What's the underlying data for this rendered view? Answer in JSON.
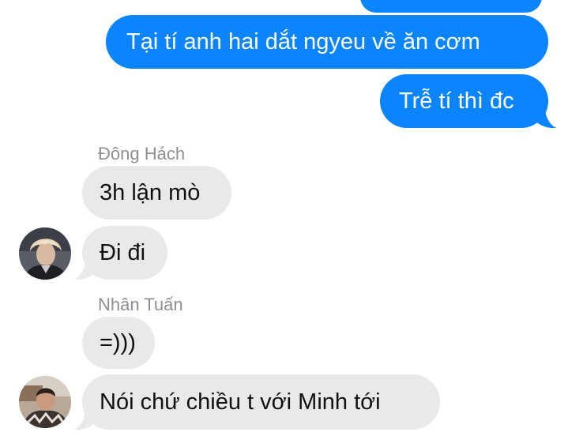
{
  "conversation": {
    "messages": [
      {
        "id": "m0",
        "direction": "outgoing",
        "text": ""
      },
      {
        "id": "m1",
        "direction": "outgoing",
        "text": "Tại tí anh hai dắt ngyeu về ăn cơm"
      },
      {
        "id": "m2",
        "direction": "outgoing",
        "text": "Trễ tí thì đc"
      },
      {
        "id": "m3",
        "direction": "incoming",
        "sender": "Đông Hách",
        "text": "3h lận mò"
      },
      {
        "id": "m4",
        "direction": "incoming",
        "text": "Đi đi"
      },
      {
        "id": "m5",
        "direction": "incoming",
        "sender": "Nhân Tuấn",
        "text": "=)))"
      },
      {
        "id": "m6",
        "direction": "incoming",
        "text": "Nói chứ chiều t với Minh tới"
      }
    ]
  },
  "colors": {
    "outgoing_bubble": "#0a84ff",
    "incoming_bubble": "#e9e9eb",
    "sender_name": "#8e8e93"
  },
  "icons": {
    "avatar_1": "avatar-donghach",
    "avatar_2": "avatar-nhantuan"
  }
}
